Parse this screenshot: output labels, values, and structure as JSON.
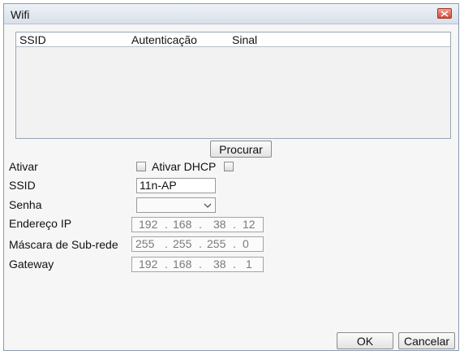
{
  "window": {
    "title": "Wifi"
  },
  "list": {
    "columns": [
      "SSID",
      "Autenticação",
      "Sinal"
    ]
  },
  "search_button": "Procurar",
  "form": {
    "ativar_label": "Ativar",
    "ativar_dhcp_label": "Ativar DHCP",
    "ssid_label": "SSID",
    "ssid_value": "11n-AP",
    "senha_label": "Senha",
    "ip_label": "Endereço IP",
    "ip": [
      "192",
      "168",
      "38",
      "12"
    ],
    "mask_label": "Máscara de Sub-rede",
    "mask": [
      "255",
      "255",
      "255",
      "0"
    ],
    "gateway_label": "Gateway",
    "gateway": [
      "192",
      "168",
      "38",
      "1"
    ]
  },
  "buttons": {
    "ok": "OK",
    "cancel": "Cancelar"
  }
}
